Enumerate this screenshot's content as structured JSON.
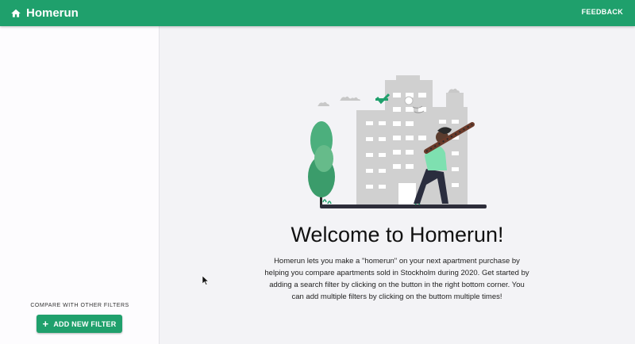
{
  "appbar": {
    "title": "Homerun",
    "home_icon": "home-icon",
    "feedback_label": "FEEDBACK",
    "color": "#1fa06c"
  },
  "sidebar": {
    "compare_label": "COMPARE WITH OTHER FILTERS",
    "add_filter_label": "ADD NEW FILTER",
    "add_icon": "plus-icon"
  },
  "main": {
    "welcome_title": "Welcome to Homerun!",
    "description": "Homerun lets you make a \"homerun\" on your next apartment purchase by helping you compare apartments sold in Stockholm during 2020. Get started by adding a search filter by clicking on the button in the right bottom corner. You can add multiple filters by clicking on the buttom multiple times!"
  },
  "colors": {
    "accent": "#1fa06c",
    "background": "#f3f3f6",
    "sidebar": "#fdfcfe"
  }
}
